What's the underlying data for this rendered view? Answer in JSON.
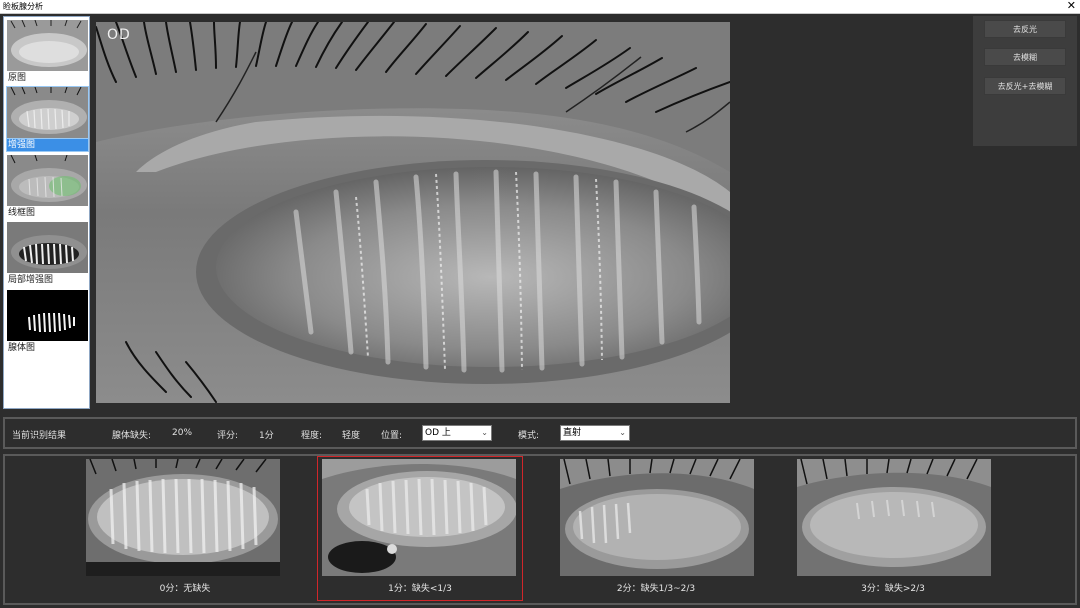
{
  "window": {
    "title": "睑板腺分析",
    "close_glyph": "✕"
  },
  "thumbnails": [
    {
      "label": "原图",
      "selected": false
    },
    {
      "label": "增强图",
      "selected": true
    },
    {
      "label": "线框图",
      "selected": false
    },
    {
      "label": "局部增强图",
      "selected": false
    },
    {
      "label": "腺体图",
      "selected": false
    }
  ],
  "main_image": {
    "eye_label": "OD"
  },
  "tools": [
    {
      "label": "去反光"
    },
    {
      "label": "去模糊"
    },
    {
      "label": "去反光+去模糊"
    }
  ],
  "result": {
    "section_label": "当前识别结果",
    "gland_loss_label": "腺体缺失:",
    "gland_loss_value": "20%",
    "score_label": "评分:",
    "score_value": "1分",
    "degree_label": "程度:",
    "degree_value": "轻度",
    "position_label": "位置:",
    "position_value": "OD 上",
    "mode_label": "模式:",
    "mode_value": "直射"
  },
  "examples": [
    {
      "label": "0分：无缺失",
      "selected": false
    },
    {
      "label": "1分：缺失<1/3",
      "selected": true
    },
    {
      "label": "2分：缺失1/3~2/3",
      "selected": false
    },
    {
      "label": "3分：缺失>2/3",
      "selected": false
    }
  ],
  "colors": {
    "selection_blue": "#3b8fe6",
    "selected_example_border": "#d0262a"
  }
}
